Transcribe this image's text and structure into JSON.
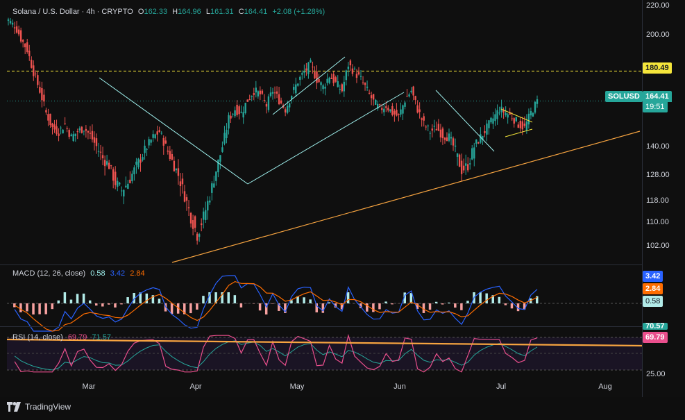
{
  "header": {
    "symbol": "Solana / U.S. Dollar · 4h · CRYPTO",
    "open_label": "O",
    "open": "162.33",
    "high_label": "H",
    "high": "164.96",
    "low_label": "L",
    "low": "161.31",
    "close_label": "C",
    "close": "164.41",
    "change": "+2.08 (+1.28%)"
  },
  "price_axis": [
    "220.00",
    "200.00",
    "140.00",
    "128.00",
    "118.00",
    "110.00",
    "102.00"
  ],
  "price_tags": {
    "resistance": "180.49",
    "symbol_tag": "SOLUSD",
    "last_price": "164.41",
    "countdown": "19:51"
  },
  "macd": {
    "label": "MACD (12, 26, close)",
    "v1": "0.58",
    "v2": "3.42",
    "v3": "2.84",
    "tag_macd": "3.42",
    "tag_signal": "2.84",
    "tag_hist": "0.58"
  },
  "rsi": {
    "label": "RSI (14, close)",
    "value": "69.79",
    "value2": "71.57",
    "tag_value": "69.79",
    "tag_value2": "70.57",
    "axis_low": "25.00"
  },
  "time_axis": [
    "Mar",
    "Apr",
    "May",
    "Jun",
    "Jul",
    "Aug"
  ],
  "footer": {
    "brand": "TradingView"
  },
  "colors": {
    "up": "#26a69a",
    "down": "#ef5350",
    "accent_yellow": "#f5e63b",
    "trend_orange": "#f7a440",
    "trend_cyan": "#9ff1ee",
    "macd_blue": "#2962ff",
    "signal_orange": "#ff6d00",
    "rsi_pink": "#ea4f8d"
  },
  "chart_data": {
    "type": "candlestick",
    "symbol": "SOLUSD",
    "interval": "4h",
    "close": [
      210,
      206,
      198,
      192,
      180,
      170,
      158,
      150,
      148,
      152,
      145,
      148,
      150,
      146,
      140,
      135,
      132,
      125,
      122,
      125,
      130,
      135,
      140,
      145,
      148,
      140,
      134,
      128,
      120,
      112,
      106,
      112,
      120,
      130,
      140,
      155,
      160,
      158,
      165,
      170,
      168,
      162,
      170,
      165,
      160,
      168,
      175,
      180,
      184,
      176,
      172,
      178,
      174,
      170,
      184,
      180,
      176,
      170,
      164,
      160,
      162,
      158,
      156,
      165,
      170,
      160,
      152,
      148,
      150,
      146,
      145,
      138,
      130,
      132,
      140,
      145,
      150,
      155,
      160,
      158,
      156,
      152,
      150,
      158,
      164
    ],
    "ylim": [
      96,
      224
    ],
    "x_months": [
      "Mar",
      "Apr",
      "May",
      "Jun",
      "Jul",
      "Aug"
    ],
    "levels": [
      180.49
    ]
  }
}
